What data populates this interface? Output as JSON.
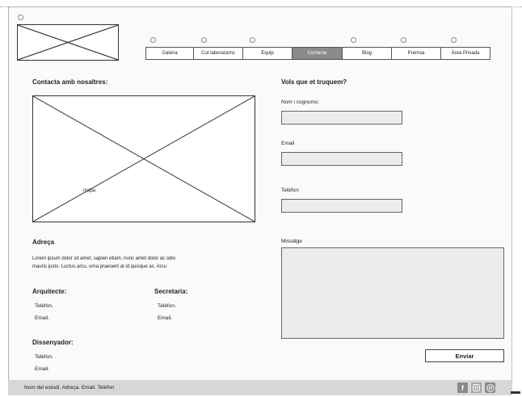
{
  "nav": {
    "items": [
      {
        "label": "Galeria"
      },
      {
        "label": "Col·laboracions"
      },
      {
        "label": "Equip"
      },
      {
        "label": "Contacte",
        "active": true
      },
      {
        "label": "Blog"
      },
      {
        "label": "Premsa"
      },
      {
        "label": "Àrea Privada"
      }
    ]
  },
  "contact": {
    "title": "Contacta amb nosaltres:",
    "map_label": "mapa",
    "address_title": "Adreça",
    "address_text_line1": "Lorem ipsum dolor sit amet, sapien etiam, nunc amet dolor ac odio",
    "address_text_line2": "mauris justo. Luctus arcu, urna praesent at id quisque ac. Arcu",
    "architect_title": "Arquitecte:",
    "architect_phone": "Telèfon.",
    "architect_email": "Email.",
    "secretary_title": "Secretaria:",
    "secretary_phone": "Telèfon.",
    "secretary_email": "Email.",
    "designer_title": "Dissenyador:",
    "designer_phone": "Telèfon.",
    "designer_email": "Email."
  },
  "form": {
    "title": "Vols que et truquem?",
    "name_label": "Nom i cognoms:",
    "email_label": "Email",
    "phone_label": "Telèfon:",
    "message_label": "Missatge",
    "send_label": "Enviar"
  },
  "footer": {
    "text": "Nom del estudi. Adreça. Email. Telèfon",
    "icons": [
      "facebook-icon",
      "instagram-icon",
      "pinterest-icon"
    ]
  }
}
